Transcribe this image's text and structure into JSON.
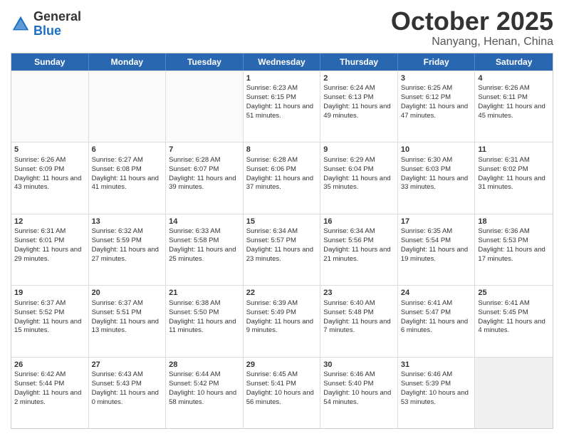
{
  "header": {
    "logo": {
      "general": "General",
      "blue": "Blue"
    },
    "title": "October 2025",
    "location": "Nanyang, Henan, China"
  },
  "days_of_week": [
    "Sunday",
    "Monday",
    "Tuesday",
    "Wednesday",
    "Thursday",
    "Friday",
    "Saturday"
  ],
  "weeks": [
    [
      {
        "day": "",
        "sunrise": "",
        "sunset": "",
        "daylight": "",
        "empty": true
      },
      {
        "day": "",
        "sunrise": "",
        "sunset": "",
        "daylight": "",
        "empty": true
      },
      {
        "day": "",
        "sunrise": "",
        "sunset": "",
        "daylight": "",
        "empty": true
      },
      {
        "day": "1",
        "sunrise": "Sunrise: 6:23 AM",
        "sunset": "Sunset: 6:15 PM",
        "daylight": "Daylight: 11 hours and 51 minutes."
      },
      {
        "day": "2",
        "sunrise": "Sunrise: 6:24 AM",
        "sunset": "Sunset: 6:13 PM",
        "daylight": "Daylight: 11 hours and 49 minutes."
      },
      {
        "day": "3",
        "sunrise": "Sunrise: 6:25 AM",
        "sunset": "Sunset: 6:12 PM",
        "daylight": "Daylight: 11 hours and 47 minutes."
      },
      {
        "day": "4",
        "sunrise": "Sunrise: 6:26 AM",
        "sunset": "Sunset: 6:11 PM",
        "daylight": "Daylight: 11 hours and 45 minutes."
      }
    ],
    [
      {
        "day": "5",
        "sunrise": "Sunrise: 6:26 AM",
        "sunset": "Sunset: 6:09 PM",
        "daylight": "Daylight: 11 hours and 43 minutes."
      },
      {
        "day": "6",
        "sunrise": "Sunrise: 6:27 AM",
        "sunset": "Sunset: 6:08 PM",
        "daylight": "Daylight: 11 hours and 41 minutes."
      },
      {
        "day": "7",
        "sunrise": "Sunrise: 6:28 AM",
        "sunset": "Sunset: 6:07 PM",
        "daylight": "Daylight: 11 hours and 39 minutes."
      },
      {
        "day": "8",
        "sunrise": "Sunrise: 6:28 AM",
        "sunset": "Sunset: 6:06 PM",
        "daylight": "Daylight: 11 hours and 37 minutes."
      },
      {
        "day": "9",
        "sunrise": "Sunrise: 6:29 AM",
        "sunset": "Sunset: 6:04 PM",
        "daylight": "Daylight: 11 hours and 35 minutes."
      },
      {
        "day": "10",
        "sunrise": "Sunrise: 6:30 AM",
        "sunset": "Sunset: 6:03 PM",
        "daylight": "Daylight: 11 hours and 33 minutes."
      },
      {
        "day": "11",
        "sunrise": "Sunrise: 6:31 AM",
        "sunset": "Sunset: 6:02 PM",
        "daylight": "Daylight: 11 hours and 31 minutes."
      }
    ],
    [
      {
        "day": "12",
        "sunrise": "Sunrise: 6:31 AM",
        "sunset": "Sunset: 6:01 PM",
        "daylight": "Daylight: 11 hours and 29 minutes."
      },
      {
        "day": "13",
        "sunrise": "Sunrise: 6:32 AM",
        "sunset": "Sunset: 5:59 PM",
        "daylight": "Daylight: 11 hours and 27 minutes."
      },
      {
        "day": "14",
        "sunrise": "Sunrise: 6:33 AM",
        "sunset": "Sunset: 5:58 PM",
        "daylight": "Daylight: 11 hours and 25 minutes."
      },
      {
        "day": "15",
        "sunrise": "Sunrise: 6:34 AM",
        "sunset": "Sunset: 5:57 PM",
        "daylight": "Daylight: 11 hours and 23 minutes."
      },
      {
        "day": "16",
        "sunrise": "Sunrise: 6:34 AM",
        "sunset": "Sunset: 5:56 PM",
        "daylight": "Daylight: 11 hours and 21 minutes."
      },
      {
        "day": "17",
        "sunrise": "Sunrise: 6:35 AM",
        "sunset": "Sunset: 5:54 PM",
        "daylight": "Daylight: 11 hours and 19 minutes."
      },
      {
        "day": "18",
        "sunrise": "Sunrise: 6:36 AM",
        "sunset": "Sunset: 5:53 PM",
        "daylight": "Daylight: 11 hours and 17 minutes."
      }
    ],
    [
      {
        "day": "19",
        "sunrise": "Sunrise: 6:37 AM",
        "sunset": "Sunset: 5:52 PM",
        "daylight": "Daylight: 11 hours and 15 minutes."
      },
      {
        "day": "20",
        "sunrise": "Sunrise: 6:37 AM",
        "sunset": "Sunset: 5:51 PM",
        "daylight": "Daylight: 11 hours and 13 minutes."
      },
      {
        "day": "21",
        "sunrise": "Sunrise: 6:38 AM",
        "sunset": "Sunset: 5:50 PM",
        "daylight": "Daylight: 11 hours and 11 minutes."
      },
      {
        "day": "22",
        "sunrise": "Sunrise: 6:39 AM",
        "sunset": "Sunset: 5:49 PM",
        "daylight": "Daylight: 11 hours and 9 minutes."
      },
      {
        "day": "23",
        "sunrise": "Sunrise: 6:40 AM",
        "sunset": "Sunset: 5:48 PM",
        "daylight": "Daylight: 11 hours and 7 minutes."
      },
      {
        "day": "24",
        "sunrise": "Sunrise: 6:41 AM",
        "sunset": "Sunset: 5:47 PM",
        "daylight": "Daylight: 11 hours and 6 minutes."
      },
      {
        "day": "25",
        "sunrise": "Sunrise: 6:41 AM",
        "sunset": "Sunset: 5:45 PM",
        "daylight": "Daylight: 11 hours and 4 minutes."
      }
    ],
    [
      {
        "day": "26",
        "sunrise": "Sunrise: 6:42 AM",
        "sunset": "Sunset: 5:44 PM",
        "daylight": "Daylight: 11 hours and 2 minutes."
      },
      {
        "day": "27",
        "sunrise": "Sunrise: 6:43 AM",
        "sunset": "Sunset: 5:43 PM",
        "daylight": "Daylight: 11 hours and 0 minutes."
      },
      {
        "day": "28",
        "sunrise": "Sunrise: 6:44 AM",
        "sunset": "Sunset: 5:42 PM",
        "daylight": "Daylight: 10 hours and 58 minutes."
      },
      {
        "day": "29",
        "sunrise": "Sunrise: 6:45 AM",
        "sunset": "Sunset: 5:41 PM",
        "daylight": "Daylight: 10 hours and 56 minutes."
      },
      {
        "day": "30",
        "sunrise": "Sunrise: 6:46 AM",
        "sunset": "Sunset: 5:40 PM",
        "daylight": "Daylight: 10 hours and 54 minutes."
      },
      {
        "day": "31",
        "sunrise": "Sunrise: 6:46 AM",
        "sunset": "Sunset: 5:39 PM",
        "daylight": "Daylight: 10 hours and 53 minutes."
      },
      {
        "day": "",
        "sunrise": "",
        "sunset": "",
        "daylight": "",
        "empty": true,
        "shaded": true
      }
    ]
  ]
}
